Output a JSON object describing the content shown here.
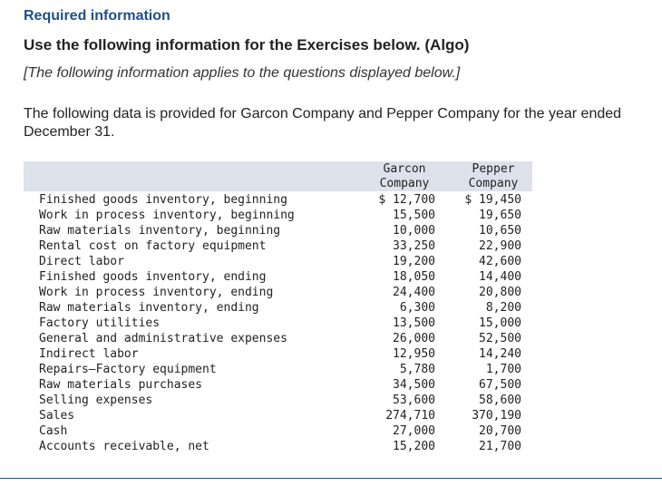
{
  "header": {
    "required": "Required information",
    "title": "Use the following information for the Exercises below. (Algo)",
    "note": "[The following information applies to the questions displayed below.]"
  },
  "intro": "The following data is provided for Garcon Company and Pepper Company for the year ended December 31.",
  "table": {
    "col_garcon_line1": "Garcon",
    "col_garcon_line2": "Company",
    "col_pepper_line1": "Pepper",
    "col_pepper_line2": "Company",
    "rows": [
      {
        "label": "Finished goods inventory, beginning",
        "garcon": "$ 12,700",
        "pepper": "$ 19,450"
      },
      {
        "label": "Work in process inventory, beginning",
        "garcon": "15,500",
        "pepper": "19,650"
      },
      {
        "label": "Raw materials inventory, beginning",
        "garcon": "10,000",
        "pepper": "10,650"
      },
      {
        "label": "Rental cost on factory equipment",
        "garcon": "33,250",
        "pepper": "22,900"
      },
      {
        "label": "Direct labor",
        "garcon": "19,200",
        "pepper": "42,600"
      },
      {
        "label": "Finished goods inventory, ending",
        "garcon": "18,050",
        "pepper": "14,400"
      },
      {
        "label": "Work in process inventory, ending",
        "garcon": "24,400",
        "pepper": "20,800"
      },
      {
        "label": "Raw materials inventory, ending",
        "garcon": "6,300",
        "pepper": "8,200"
      },
      {
        "label": "Factory utilities",
        "garcon": "13,500",
        "pepper": "15,000"
      },
      {
        "label": "General and administrative expenses",
        "garcon": "26,000",
        "pepper": "52,500"
      },
      {
        "label": "Indirect labor",
        "garcon": "12,950",
        "pepper": "14,240"
      },
      {
        "label": "Repairs—Factory equipment",
        "garcon": "5,780",
        "pepper": "1,700"
      },
      {
        "label": "Raw materials purchases",
        "garcon": "34,500",
        "pepper": "67,500"
      },
      {
        "label": "Selling expenses",
        "garcon": "53,600",
        "pepper": "58,600"
      },
      {
        "label": "Sales",
        "garcon": "274,710",
        "pepper": "370,190"
      },
      {
        "label": "Cash",
        "garcon": "27,000",
        "pepper": "20,700"
      },
      {
        "label": "Accounts receivable, net",
        "garcon": "15,200",
        "pepper": "21,700"
      }
    ]
  }
}
